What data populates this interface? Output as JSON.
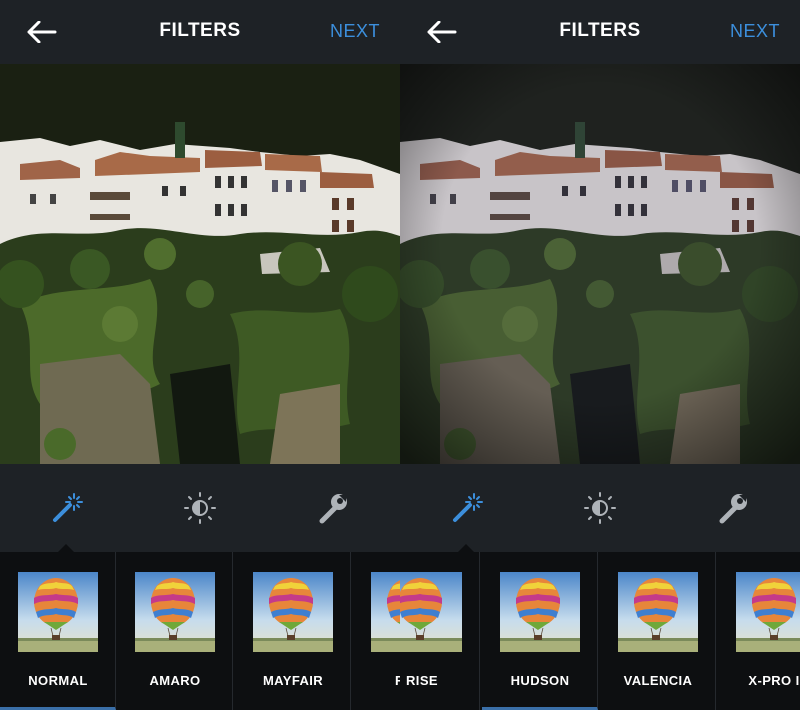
{
  "left_screen": {
    "header": {
      "title": "FILTERS",
      "next_label": "NEXT"
    },
    "filters": [
      {
        "label": "NORMAL",
        "selected": true
      },
      {
        "label": "AMARO",
        "selected": false
      },
      {
        "label": "MAYFAIR",
        "selected": false
      },
      {
        "label": "RISE",
        "selected": false
      }
    ],
    "active_tool": "filter-wand"
  },
  "right_screen": {
    "header": {
      "title": "FILTERS",
      "next_label": "NEXT"
    },
    "filters": [
      {
        "label": "RISE",
        "selected": false
      },
      {
        "label": "HUDSON",
        "selected": true
      },
      {
        "label": "VALENCIA",
        "selected": false
      },
      {
        "label": "X-PRO II",
        "selected": false
      }
    ],
    "active_tool": "filter-wand"
  },
  "tools": {
    "filter": "magic-wand-icon",
    "lux": "brightness-icon",
    "edit": "wrench-icon"
  },
  "colors": {
    "accent": "#3c8fdc",
    "bar": "#1e2226",
    "strip": "#0d0f11",
    "selected_underline": "#3a6fa8"
  }
}
